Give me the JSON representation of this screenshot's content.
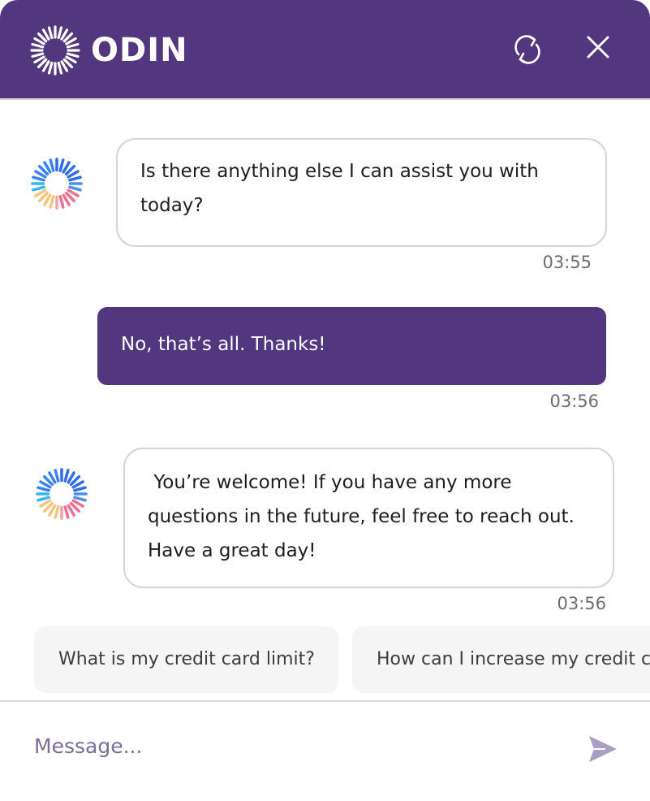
{
  "header": {
    "brand": "ODIN",
    "logo_icon": "odin-sunburst-logo",
    "refresh_icon": "refresh-icon",
    "close_icon": "close-icon",
    "color": "#52367e"
  },
  "messages": [
    {
      "sender": "bot",
      "text": "Is there anything else I can assist you with today?",
      "time": "03:55"
    },
    {
      "sender": "user",
      "text": "No, that’s all. Thanks!",
      "time": "03:56"
    },
    {
      "sender": "bot",
      "text": " You’re welcome! If you have any more questions in the future, feel free to reach out. Have a great day!",
      "time": "03:56"
    }
  ],
  "suggestions": [
    "What is my credit card limit?",
    "How can I increase my credit card limit?"
  ],
  "composer": {
    "placeholder": "Message...",
    "value": "",
    "send_icon": "send-icon"
  }
}
